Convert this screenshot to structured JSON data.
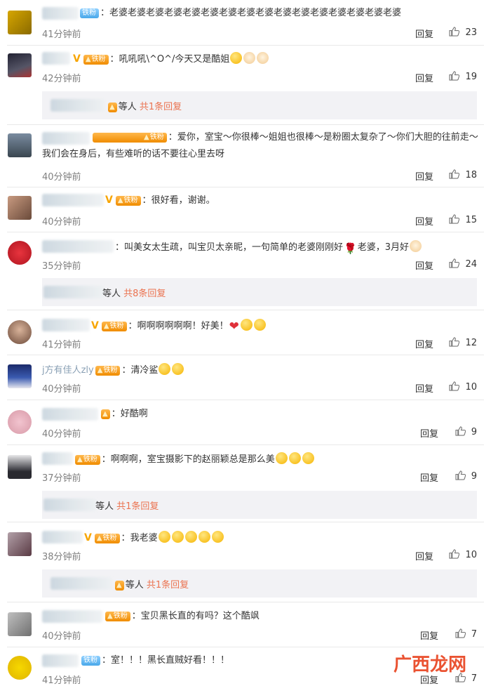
{
  "ui": {
    "reply_label": "回复"
  },
  "comments": [
    {
      "name": "",
      "text": "老婆老婆老婆老婆老婆老婆老婆老婆老婆老婆老婆老婆老婆老婆老婆老婆",
      "fan": "铁粉",
      "time": "41分钟前",
      "likes": "23"
    },
    {
      "name": "",
      "text": "吼吼吼\\^O^/今天又是酷姐",
      "fan": "铁粉",
      "time": "42分钟前",
      "likes": "19",
      "subreplies": {
        "suffix": "等人",
        "count": "共1条回复"
      }
    },
    {
      "name": "",
      "text": "爱你，室宝～你很棒～姐姐也很棒～是粉圈太复杂了～你们大胆的往前走～我们会在身后，有些难听的话不要往心里去呀",
      "fan": "铁粉",
      "time": "40分钟前",
      "likes": "18"
    },
    {
      "name": "",
      "text": "很好看，谢谢。",
      "fan": "铁粉",
      "time": "40分钟前",
      "likes": "15"
    },
    {
      "name": "",
      "text": "叫美女太生疏，叫宝贝太亲昵，一句简单的老婆刚刚好",
      "text_tail": "老婆，3月好",
      "time": "35分钟前",
      "likes": "24",
      "subreplies": {
        "suffix": "等人",
        "count": "共8条回复"
      }
    },
    {
      "name": "",
      "text": "啊啊啊啊啊啊！好美！",
      "fan": "铁粉",
      "time": "41分钟前",
      "likes": "12"
    },
    {
      "name": "j方有佳人zly",
      "text": "清冷鲨",
      "fan": "铁粉",
      "time": "40分钟前",
      "likes": "10"
    },
    {
      "name": "",
      "text": "好酷啊",
      "time": "40分钟前",
      "likes": "9"
    },
    {
      "name": "",
      "text": "啊啊啊，室宝摄影下的赵丽颖总是那么美",
      "fan": "铁粉",
      "time": "37分钟前",
      "likes": "9",
      "subreplies": {
        "suffix": "等人",
        "count": "共1条回复"
      }
    },
    {
      "name": "",
      "text": "我老婆",
      "fan": "铁粉",
      "time": "38分钟前",
      "likes": "10",
      "subreplies": {
        "suffix": "等人",
        "count": "共1条回复"
      }
    },
    {
      "name": "",
      "text": "宝贝黑长直的有吗？这个酷飒",
      "fan": "铁粉",
      "time": "40分钟前",
      "likes": "7"
    },
    {
      "name": "",
      "text": "室！！！黑长直贼好看！！！",
      "fan": "铁粉",
      "time": "41分钟前",
      "likes": "7"
    }
  ],
  "watermark": {
    "text": "广西龙网"
  },
  "colors": {
    "link": "#eb7350",
    "fan_badge": "#f08c00",
    "v_badge": "#f7a500",
    "time": "#808080",
    "divider": "#e9e9e9"
  }
}
